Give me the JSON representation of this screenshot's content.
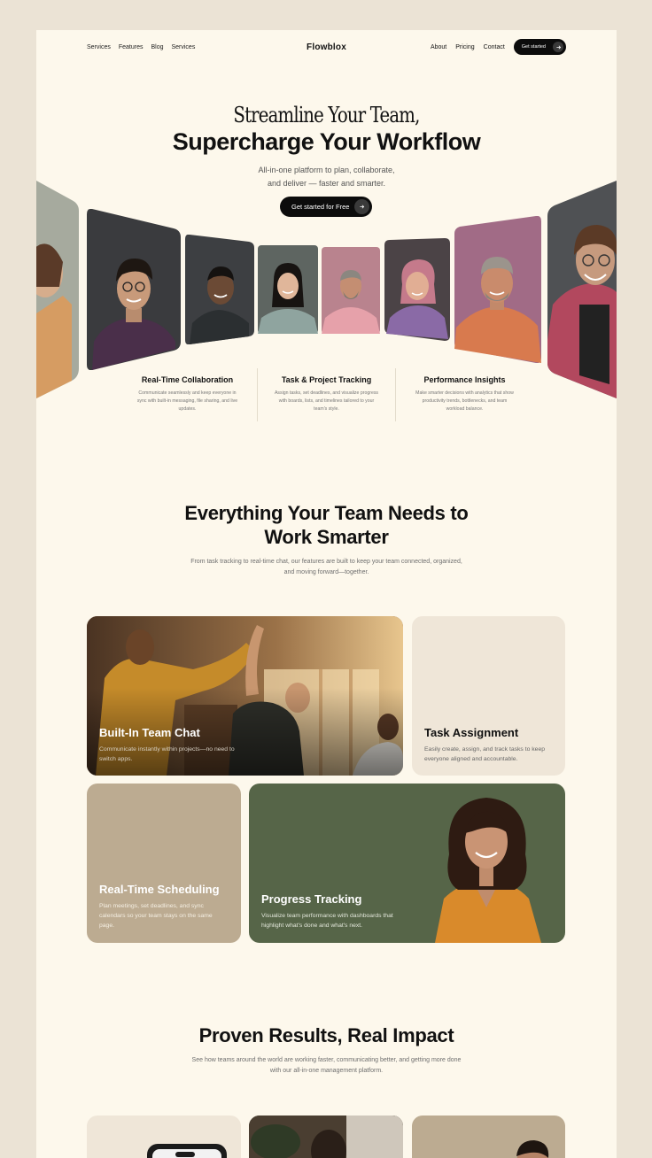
{
  "nav": {
    "left": [
      "Services",
      "Features",
      "Blog",
      "Services"
    ],
    "logo": "Flowblox",
    "right": [
      "About",
      "Pricing",
      "Contact"
    ],
    "cta": "Get started"
  },
  "hero": {
    "line1": "Streamline Your Team,",
    "line2": "Supercharge Your Workflow",
    "subtitle_l1": "All-in-one platform to plan, collaborate,",
    "subtitle_l2": "and deliver — faster and smarter.",
    "cta": "Get started for Free"
  },
  "features": [
    {
      "title": "Real-Time Collaboration",
      "desc_l1": "Communicate seamlessly and keep everyone in",
      "desc_l2": "sync with built-in messaging, file sharing, and live",
      "desc_l3": "updates."
    },
    {
      "title": "Task & Project Tracking",
      "desc_l1": "Assign tasks, set deadlines, and visualize progress",
      "desc_l2": "with boards, lists, and timelines tailored to your",
      "desc_l3": "team's style."
    },
    {
      "title": "Performance Insights",
      "desc_l1": "Make smarter decisions with analytics that show",
      "desc_l2": "productivity trends, bottlenecks, and team",
      "desc_l3": "workload balance."
    }
  ],
  "section2": {
    "title_l1": "Everything Your Team Needs to",
    "title_l2": "Work Smarter",
    "sub_l1": "From task tracking to real-time chat, our features are built to keep your team connected, organized,",
    "sub_l2": "and moving forward—together."
  },
  "tiles": {
    "chat": {
      "title": "Built-In Team Chat",
      "desc_l1": "Communicate instantly within projects—no need to",
      "desc_l2": "switch apps."
    },
    "task": {
      "title": "Task Assignment",
      "desc_l1": "Easily create, assign, and track tasks to keep",
      "desc_l2": "everyone aligned and accountable."
    },
    "schedule": {
      "title": "Real-Time Scheduling",
      "desc_l1": "Plan meetings, set deadlines, and sync",
      "desc_l2": "calendars so your team stays on the same",
      "desc_l3": "page."
    },
    "progress": {
      "title": "Progress Tracking",
      "desc_l1": "Visualize team performance with dashboards that",
      "desc_l2": "highlight what's done and what's next."
    }
  },
  "section3": {
    "title": "Proven Results, Real Impact",
    "sub_l1": "See how teams around the world are working faster, communicating better, and getting more done",
    "sub_l2": "with our all-in-one management platform."
  },
  "colors": {
    "page": "#fdf8ec",
    "outer": "#ebe3d5",
    "dark": "#0c0c0c",
    "sage": "#566548",
    "tan": "#bcab91",
    "cream_tile": "#efe6d8"
  }
}
